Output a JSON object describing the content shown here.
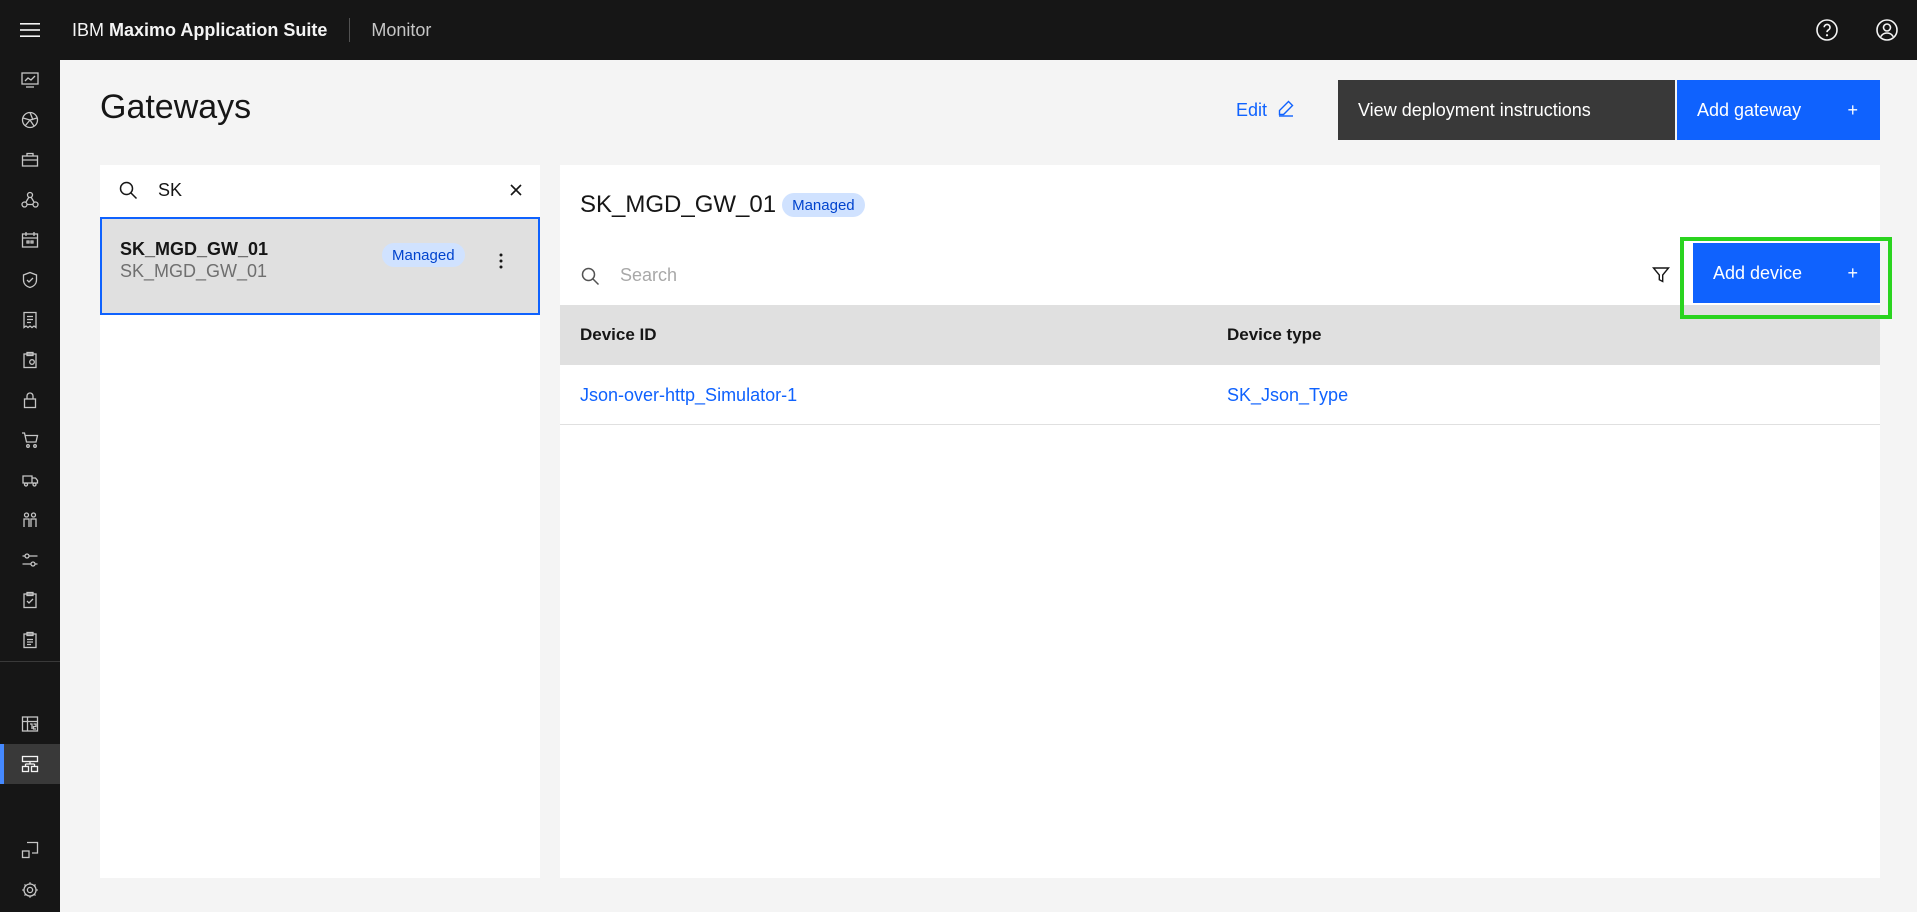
{
  "header": {
    "brand_prefix": "IBM",
    "brand_name": "Maximo Application Suite",
    "app_name": "Monitor"
  },
  "page": {
    "title": "Gateways",
    "edit_label": "Edit",
    "view_instructions_label": "View deployment instructions",
    "add_gateway_label": "Add gateway",
    "add_gateway_icon": "+"
  },
  "gateway_list": {
    "search_value": "SK",
    "items": [
      {
        "name": "SK_MGD_GW_01",
        "subtitle": "SK_MGD_GW_01",
        "tag": "Managed",
        "selected": true
      }
    ]
  },
  "detail": {
    "name": "SK_MGD_GW_01",
    "tag": "Managed",
    "search_placeholder": "Search",
    "add_device_label": "Add device",
    "add_device_icon": "+",
    "columns": [
      "Device ID",
      "Device type"
    ],
    "rows": [
      {
        "device_id": "Json-over-http_Simulator-1",
        "device_type": "SK_Json_Type"
      }
    ]
  },
  "colors": {
    "primary": "#0f62fe",
    "header_bg": "#161616",
    "tag_bg": "#d0e2ff",
    "highlight": "#2ad41f"
  },
  "icons": {
    "hamburger": "menu-icon",
    "help": "help-icon",
    "user": "user-avatar-icon",
    "search": "search-icon",
    "clear": "close-icon",
    "overflow": "overflow-menu-icon",
    "filter": "filter-icon",
    "edit": "pencil-icon"
  }
}
